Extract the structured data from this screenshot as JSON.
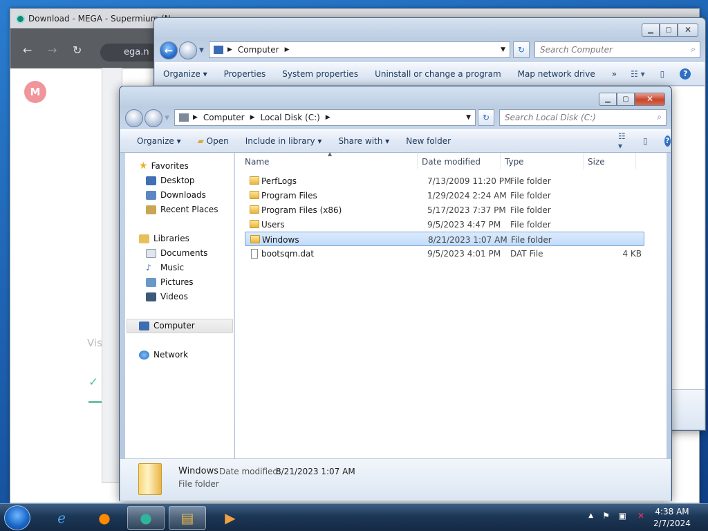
{
  "browser": {
    "tab_title": "Download - MEGA - Supermium (N",
    "address": "ega.n",
    "dialog_text": "Vis",
    "logo_letter": "M"
  },
  "computer_window": {
    "address_segments": [
      "Computer"
    ],
    "search_placeholder": "Search Computer",
    "commands": [
      "Organize",
      "Properties",
      "System properties",
      "Uninstall or change a program",
      "Map network drive",
      "»"
    ]
  },
  "explorer": {
    "address_segments": [
      "Computer",
      "Local Disk (C:)"
    ],
    "search_placeholder": "Search Local Disk (C:)",
    "commands": {
      "organize": "Organize",
      "open": "Open",
      "include": "Include in library",
      "share": "Share with",
      "new_folder": "New folder"
    },
    "nav": {
      "favorites": "Favorites",
      "favorites_items": [
        "Desktop",
        "Downloads",
        "Recent Places"
      ],
      "libraries": "Libraries",
      "libraries_items": [
        "Documents",
        "Music",
        "Pictures",
        "Videos"
      ],
      "computer": "Computer",
      "network": "Network"
    },
    "columns": [
      "Name",
      "Date modified",
      "Type",
      "Size"
    ],
    "files": [
      {
        "name": "PerfLogs",
        "date": "7/13/2009 11:20 PM",
        "type": "File folder",
        "size": "",
        "icon": "folder-icon"
      },
      {
        "name": "Program Files",
        "date": "1/29/2024 2:24 AM",
        "type": "File folder",
        "size": "",
        "icon": "folder-icon"
      },
      {
        "name": "Program Files (x86)",
        "date": "5/17/2023 7:37 PM",
        "type": "File folder",
        "size": "",
        "icon": "folder-icon"
      },
      {
        "name": "Users",
        "date": "9/5/2023 4:47 PM",
        "type": "File folder",
        "size": "",
        "icon": "folder-icon"
      },
      {
        "name": "Windows",
        "date": "8/21/2023 1:07 AM",
        "type": "File folder",
        "size": "",
        "icon": "folder-icon",
        "selected": true
      },
      {
        "name": "bootsqm.dat",
        "date": "9/5/2023 4:01 PM",
        "type": "DAT File",
        "size": "4 KB",
        "icon": "file-icon"
      }
    ],
    "details": {
      "name": "Windows",
      "date_label": "Date modified:",
      "date": "8/21/2023 1:07 AM",
      "type": "File folder"
    }
  },
  "taskbar": {
    "time": "4:38 AM",
    "date": "2/7/2024"
  },
  "colors": {
    "selection": "#c1dcfc",
    "close_red": "#c8452c",
    "taskbar": "#1c3756"
  }
}
